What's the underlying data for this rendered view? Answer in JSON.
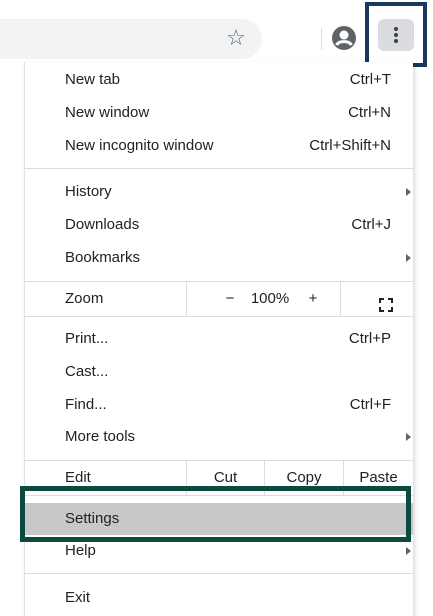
{
  "toolbar": {
    "star_icon": "star-outline-icon",
    "profile_icon": "account-circle-icon",
    "menu_icon": "more-vert-icon"
  },
  "menu": {
    "new_tab": {
      "label": "New tab",
      "shortcut": "Ctrl+T"
    },
    "new_window": {
      "label": "New window",
      "shortcut": "Ctrl+N"
    },
    "new_incognito": {
      "label": "New incognito window",
      "shortcut": "Ctrl+Shift+N"
    },
    "history": {
      "label": "History"
    },
    "downloads": {
      "label": "Downloads",
      "shortcut": "Ctrl+J"
    },
    "bookmarks": {
      "label": "Bookmarks"
    },
    "zoom": {
      "label": "Zoom",
      "minus": "−",
      "value": "100%",
      "plus": "+"
    },
    "print": {
      "label": "Print...",
      "shortcut": "Ctrl+P"
    },
    "cast": {
      "label": "Cast..."
    },
    "find": {
      "label": "Find...",
      "shortcut": "Ctrl+F"
    },
    "more_tools": {
      "label": "More tools"
    },
    "edit": {
      "label": "Edit",
      "cut": "Cut",
      "copy": "Copy",
      "paste": "Paste"
    },
    "settings": {
      "label": "Settings"
    },
    "help": {
      "label": "Help"
    },
    "exit": {
      "label": "Exit"
    }
  },
  "colors": {
    "highlight_menu_button": "#17375c",
    "highlight_settings": "#0b4a3d",
    "settings_background": "#c8c8c8"
  }
}
